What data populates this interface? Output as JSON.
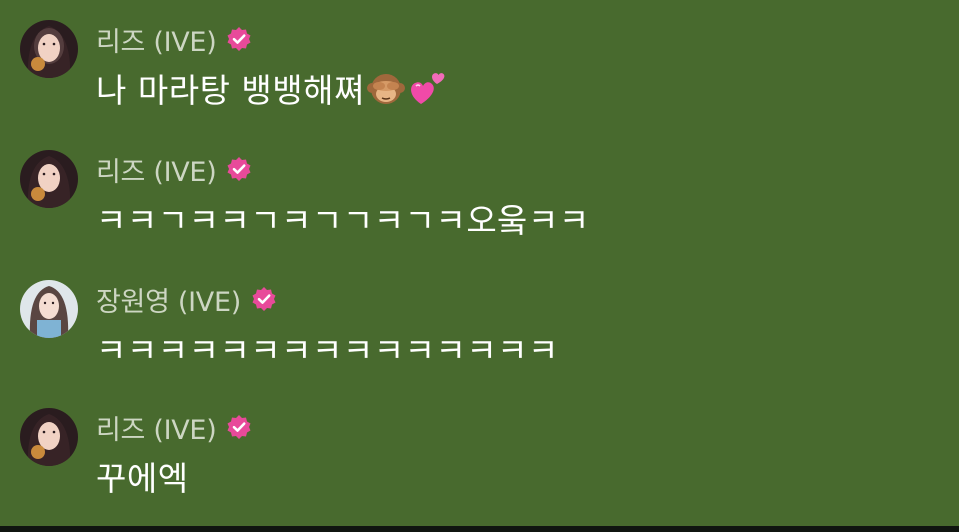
{
  "colors": {
    "background": "#486a2e",
    "name_text": "#cdd6c3",
    "message_text": "#ffffff",
    "verified_badge": "#e84a9a"
  },
  "messages": [
    {
      "author": "리즈 (IVE)",
      "avatar": "liz-avatar",
      "verified": true,
      "text": "나 마라탕 뱅뱅해쪄",
      "emojis": [
        "see-no-evil-monkey-icon",
        "two-hearts-icon"
      ]
    },
    {
      "author": "리즈 (IVE)",
      "avatar": "liz-avatar",
      "verified": true,
      "text": "ㅋㅋㄱㅋㅋㄱㅋㄱㄱㅋㄱㅋ오웈ㅋㅋ",
      "emojis": []
    },
    {
      "author": "장원영 (IVE)",
      "avatar": "wonyoung-avatar",
      "verified": true,
      "text": "ㅋㅋㅋㅋㅋㅋㅋㅋㅋㅋㅋㅋㅋㅋㅋ",
      "emojis": []
    },
    {
      "author": "리즈 (IVE)",
      "avatar": "liz-avatar",
      "verified": true,
      "text": "꾸에엑",
      "emojis": []
    }
  ]
}
